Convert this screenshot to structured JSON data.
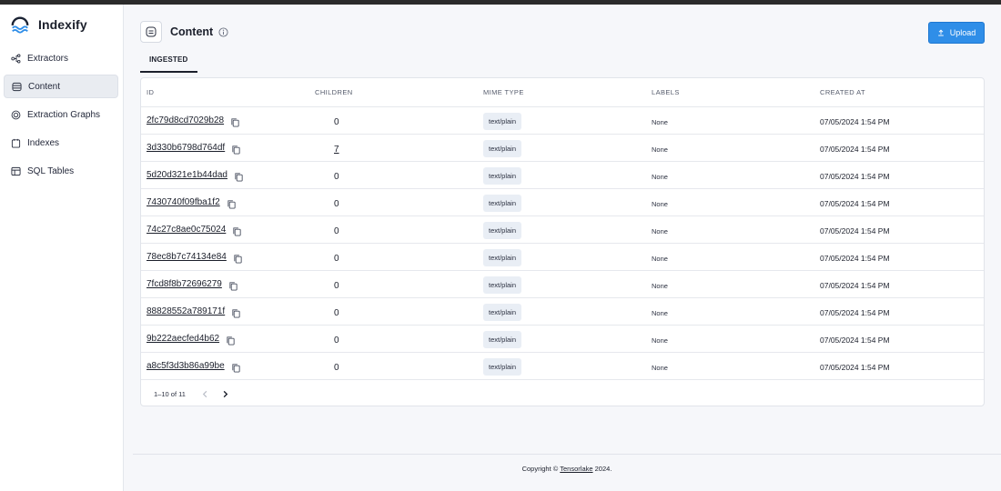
{
  "brand": {
    "name": "Indexify"
  },
  "sidebar": {
    "items": [
      {
        "label": "Extractors",
        "icon": "extractors-icon",
        "active": false
      },
      {
        "label": "Content",
        "icon": "content-icon",
        "active": true
      },
      {
        "label": "Extraction Graphs",
        "icon": "graph-icon",
        "active": false
      },
      {
        "label": "Indexes",
        "icon": "indexes-icon",
        "active": false
      },
      {
        "label": "SQL Tables",
        "icon": "table-icon",
        "active": false
      }
    ]
  },
  "header": {
    "title": "Content",
    "upload_label": "Upload"
  },
  "tabs": [
    {
      "label": "INGESTED",
      "active": true
    }
  ],
  "table": {
    "columns": [
      "ID",
      "CHILDREN",
      "MIME TYPE",
      "LABELS",
      "CREATED AT"
    ],
    "rows": [
      {
        "id": "2fc79d8cd7029b28",
        "children": "0",
        "mime": "text/plain",
        "labels": "None",
        "created": "07/05/2024 1:54 PM"
      },
      {
        "id": "3d330b6798d764df",
        "children": "7",
        "mime": "text/plain",
        "labels": "None",
        "created": "07/05/2024 1:54 PM"
      },
      {
        "id": "5d20d321e1b44dad",
        "children": "0",
        "mime": "text/plain",
        "labels": "None",
        "created": "07/05/2024 1:54 PM"
      },
      {
        "id": "7430740f09fba1f2",
        "children": "0",
        "mime": "text/plain",
        "labels": "None",
        "created": "07/05/2024 1:54 PM"
      },
      {
        "id": "74c27c8ae0c75024",
        "children": "0",
        "mime": "text/plain",
        "labels": "None",
        "created": "07/05/2024 1:54 PM"
      },
      {
        "id": "78ec8b7c74134e84",
        "children": "0",
        "mime": "text/plain",
        "labels": "None",
        "created": "07/05/2024 1:54 PM"
      },
      {
        "id": "7fcd8f8b72696279",
        "children": "0",
        "mime": "text/plain",
        "labels": "None",
        "created": "07/05/2024 1:54 PM"
      },
      {
        "id": "88828552a789171f",
        "children": "0",
        "mime": "text/plain",
        "labels": "None",
        "created": "07/05/2024 1:54 PM"
      },
      {
        "id": "9b222aecfed4b62",
        "children": "0",
        "mime": "text/plain",
        "labels": "None",
        "created": "07/05/2024 1:54 PM"
      },
      {
        "id": "a8c5f3d3b86a99be",
        "children": "0",
        "mime": "text/plain",
        "labels": "None",
        "created": "07/05/2024 1:54 PM"
      }
    ]
  },
  "pagination": {
    "text": "1–10 of 11"
  },
  "footer": {
    "prefix": "Copyright © ",
    "link": "Tensorlake",
    "suffix": " 2024."
  },
  "colors": {
    "accent": "#2f8ee8",
    "chip_bg": "#e9eef5",
    "active_nav_bg": "#e9ecf1"
  }
}
